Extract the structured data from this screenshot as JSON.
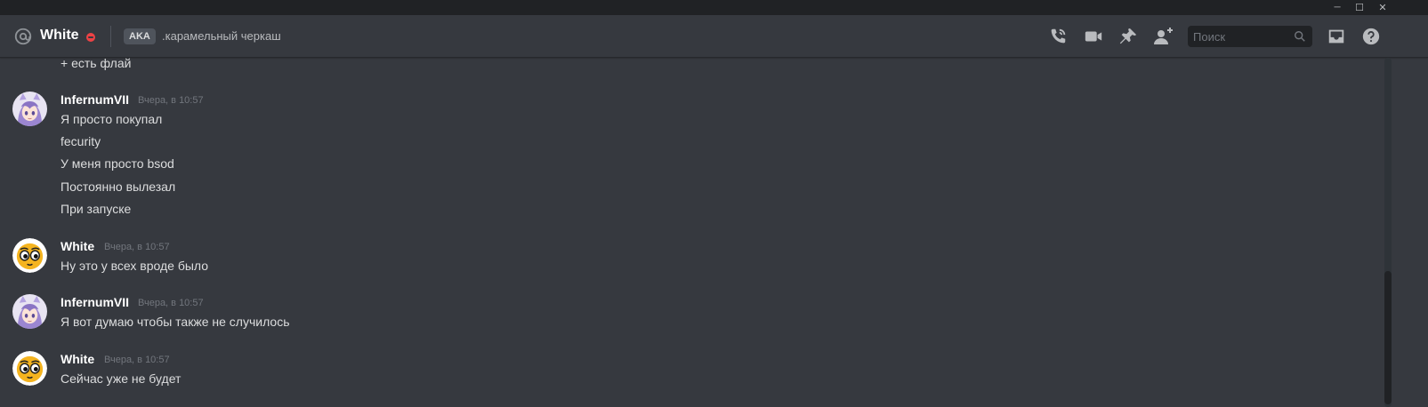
{
  "window": {
    "minimize_glyph": "─",
    "maximize_glyph": "☐",
    "close_glyph": "✕"
  },
  "header": {
    "username": "White",
    "aka_label": "AKA",
    "aka_name": ".карамельный черкаш",
    "status": "do-not-disturb",
    "status_color": "#ed4245",
    "icons": [
      "call-icon",
      "video-icon",
      "pin-icon",
      "add-friend-icon",
      "inbox-icon",
      "help-icon"
    ]
  },
  "search": {
    "placeholder": "Поиск"
  },
  "colors": {
    "background": "#36393f",
    "text": "#dcddde",
    "author": "#ffffff",
    "timestamp": "#72767d"
  },
  "messages": [
    {
      "continued": true,
      "lines": [
        "+ есть флай"
      ]
    },
    {
      "author": "InfernumVII",
      "timestamp": "Вчера, в 10:57",
      "avatar": "anime-girl-avatar",
      "lines": [
        "Я просто покупал",
        "fecurity",
        "У меня просто bsod",
        "Постоянно вылезал",
        "При запуске"
      ]
    },
    {
      "author": "White",
      "timestamp": "Вчера, в 10:57",
      "avatar": "cartoon-face-avatar",
      "lines": [
        "Ну это у всех вроде было"
      ]
    },
    {
      "author": "InfernumVII",
      "timestamp": "Вчера, в 10:57",
      "avatar": "anime-girl-avatar",
      "lines": [
        "Я вот думаю чтобы также не случилось"
      ]
    },
    {
      "author": "White",
      "timestamp": "Вчера, в 10:57",
      "avatar": "cartoon-face-avatar",
      "lines": [
        "Сейчас уже не будет"
      ]
    }
  ]
}
